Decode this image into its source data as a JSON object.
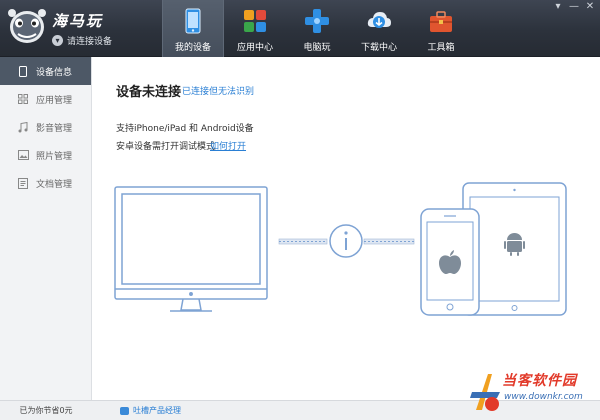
{
  "app": {
    "title": "海马玩",
    "connect_status": "请连接设备"
  },
  "nav": {
    "tabs": [
      {
        "label": "我的设备",
        "icon": "phone-icon",
        "active": true
      },
      {
        "label": "应用中心",
        "icon": "app-grid-icon",
        "active": false
      },
      {
        "label": "电脑玩",
        "icon": "gamepad-icon",
        "active": false
      },
      {
        "label": "下载中心",
        "icon": "cloud-download-icon",
        "active": false
      },
      {
        "label": "工具箱",
        "icon": "toolbox-icon",
        "active": false
      }
    ]
  },
  "window_controls": {
    "dropdown": "▾",
    "minimize": "—",
    "close": "✕"
  },
  "sidebar": {
    "items": [
      {
        "label": "设备信息",
        "icon": "phone-icon",
        "active": true
      },
      {
        "label": "应用管理",
        "icon": "grid-icon",
        "active": false
      },
      {
        "label": "影音管理",
        "icon": "music-note-icon",
        "active": false
      },
      {
        "label": "照片管理",
        "icon": "photo-icon",
        "active": false
      },
      {
        "label": "文档管理",
        "icon": "document-icon",
        "active": false
      }
    ]
  },
  "main": {
    "title": "设备未连接",
    "connected_unrecognized_link": "已连接但无法识别",
    "support_text": "支持iPhone/iPad 和 Android设备",
    "debug_text": "安卓设备需打开调试模式",
    "how_to_open_link": "如何打开"
  },
  "footer": {
    "saved_text": "已为你节省0元",
    "feedback_link": "吐槽产品经理"
  },
  "watermark": {
    "text": "当客软件园",
    "url": "www.downkr.com"
  },
  "colors": {
    "header_bg": "#2c323c",
    "accent_blue": "#2a7fd4",
    "illustration_line": "#7ea3d4",
    "sidebar_active": "#4d5866"
  }
}
